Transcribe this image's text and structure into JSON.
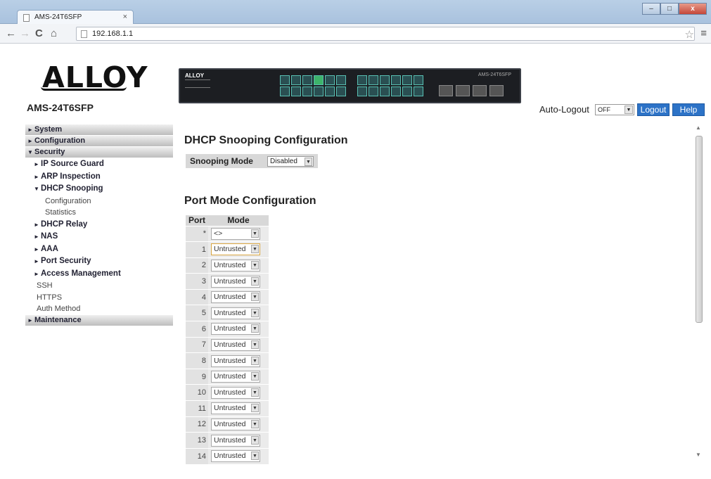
{
  "browser": {
    "tab_title": "AMS-24T6SFP",
    "tab_close": "×",
    "url": "192.168.1.1",
    "controls": {
      "minimize": "–",
      "maximize": "□",
      "close": "x"
    },
    "nav": {
      "back": "←",
      "forward": "→",
      "reload": "C",
      "home": "⌂",
      "star": "☆",
      "menu": "≡"
    }
  },
  "header": {
    "logo_text": "ALLOY",
    "model": "AMS-24T6SFP",
    "switch_logo": "ALLOY",
    "switch_model": "AMS-24T6SFP",
    "auto_logout_label": "Auto-Logout",
    "auto_logout_value": "OFF",
    "logout_label": "Logout",
    "help_label": "Help"
  },
  "sidebar": {
    "system": "System",
    "configuration": "Configuration",
    "security": "Security",
    "ip_source_guard": "IP Source Guard",
    "arp_inspection": "ARP Inspection",
    "dhcp_snooping": "DHCP Snooping",
    "dhcp_configuration": "Configuration",
    "dhcp_statistics": "Statistics",
    "dhcp_relay": "DHCP Relay",
    "nas": "NAS",
    "aaa": "AAA",
    "port_security": "Port Security",
    "access_management": "Access Management",
    "ssh": "SSH",
    "https": "HTTPS",
    "auth_method": "Auth Method",
    "maintenance": "Maintenance"
  },
  "main": {
    "dhcp_title": "DHCP Snooping Configuration",
    "snooping_mode_label": "Snooping Mode",
    "snooping_mode_value": "Disabled",
    "port_title": "Port Mode Configuration",
    "col_port": "Port",
    "col_mode": "Mode",
    "rows": [
      {
        "port": "*",
        "mode": "<>"
      },
      {
        "port": "1",
        "mode": "Untrusted"
      },
      {
        "port": "2",
        "mode": "Untrusted"
      },
      {
        "port": "3",
        "mode": "Untrusted"
      },
      {
        "port": "4",
        "mode": "Untrusted"
      },
      {
        "port": "5",
        "mode": "Untrusted"
      },
      {
        "port": "6",
        "mode": "Untrusted"
      },
      {
        "port": "7",
        "mode": "Untrusted"
      },
      {
        "port": "8",
        "mode": "Untrusted"
      },
      {
        "port": "9",
        "mode": "Untrusted"
      },
      {
        "port": "10",
        "mode": "Untrusted"
      },
      {
        "port": "11",
        "mode": "Untrusted"
      },
      {
        "port": "12",
        "mode": "Untrusted"
      },
      {
        "port": "13",
        "mode": "Untrusted"
      },
      {
        "port": "14",
        "mode": "Untrusted"
      }
    ]
  },
  "colors": {
    "accent_button": "#2d73c7",
    "nav_bar": "#bdbdbd",
    "port_led": "#59c0b3",
    "link_led": "#3db36a"
  }
}
